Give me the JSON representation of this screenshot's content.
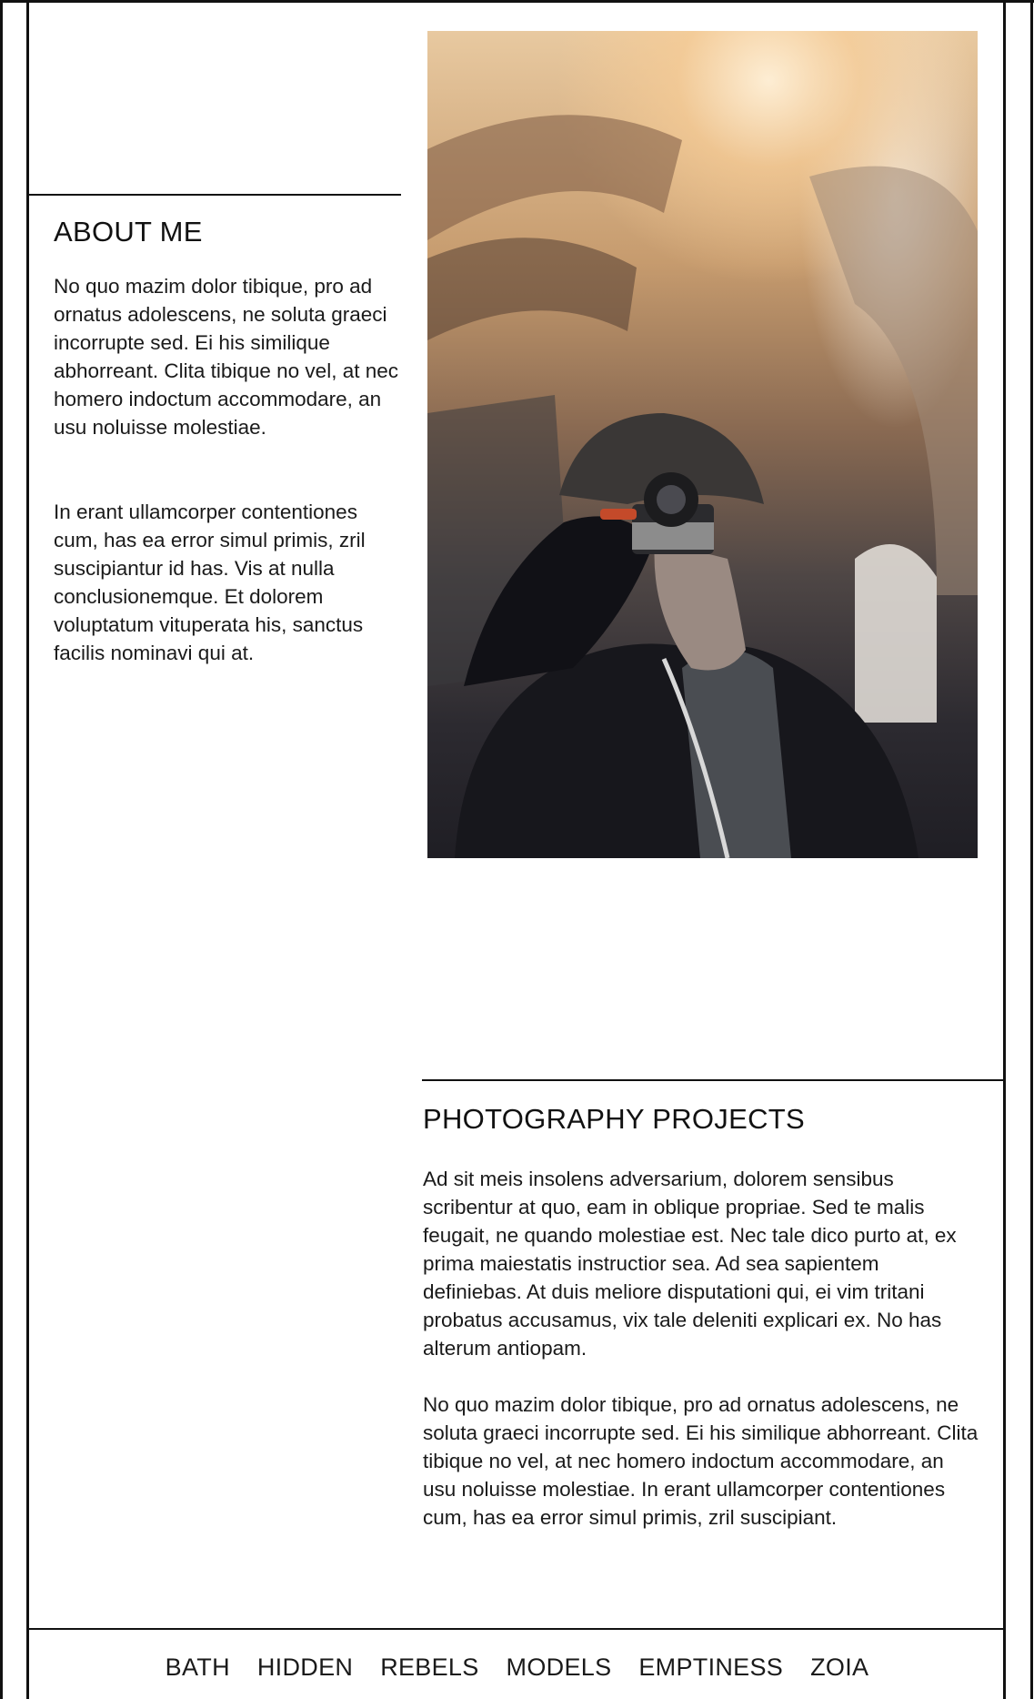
{
  "about": {
    "title": "ABOUT ME",
    "paragraphs": [
      "No quo mazim dolor tibique, pro ad ornatus adolescens, ne soluta graeci incorrupte sed. Ei his similique abhorreant. Clita tibique no vel, at nec homero indoctum accommodare, an usu noluisse molestiae.",
      "In erant ullamcorper contentiones cum, has ea error simul primis, zril suscipiantur id has. Vis at nulla conclusionemque. Et dolorem voluptatum vituperata his, sanctus facilis nominavi qui at."
    ]
  },
  "hero_image": {
    "icon": "photographer-photo"
  },
  "projects": {
    "title": "PHOTOGRAPHY PROJECTS",
    "paragraphs": [
      "Ad sit meis insolens adversarium, dolorem sensibus scribentur at quo, eam in oblique propriae. Sed te malis feugait, ne quando molestiae est. Nec tale dico purto at, ex prima maiestatis instructior sea. Ad sea sapientem definiebas. At duis meliore disputationi qui, ei vim tritani probatus accusamus, vix tale deleniti explicari ex. No has alterum antiopam.",
      "No quo mazim dolor tibique, pro ad ornatus adolescens, ne soluta graeci incorrupte sed. Ei his similique abhorreant. Clita tibique no vel, at nec homero indoctum accommodare, an usu noluisse molestiae. In erant ullamcorper contentiones cum, has ea error simul primis, zril suscipiant."
    ]
  },
  "nav": {
    "items": [
      "BATH",
      "HIDDEN",
      "REBELS",
      "MODELS",
      "EMPTINESS",
      "ZOIA"
    ]
  }
}
